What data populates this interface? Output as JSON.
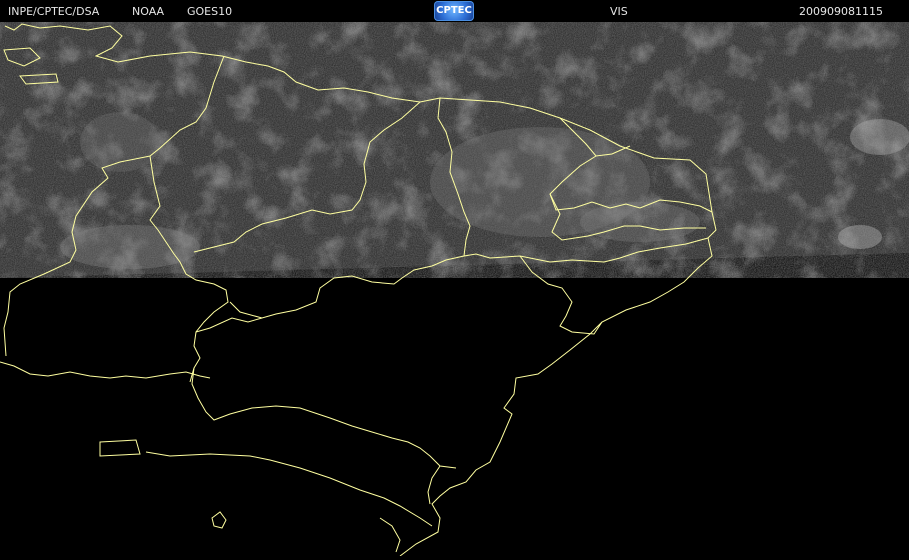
{
  "header": {
    "source": "INPE/CPTEC/DSA",
    "agency": "NOAA",
    "satellite": "GOES10",
    "logo_text": "CPTEC",
    "channel": "VIS",
    "timestamp": "200909081115"
  },
  "colors": {
    "background": "#000000",
    "cloud_dark": "#2b2b2b",
    "cloud_bright": "#8a8a8a",
    "border_line": "#ffffa0"
  }
}
